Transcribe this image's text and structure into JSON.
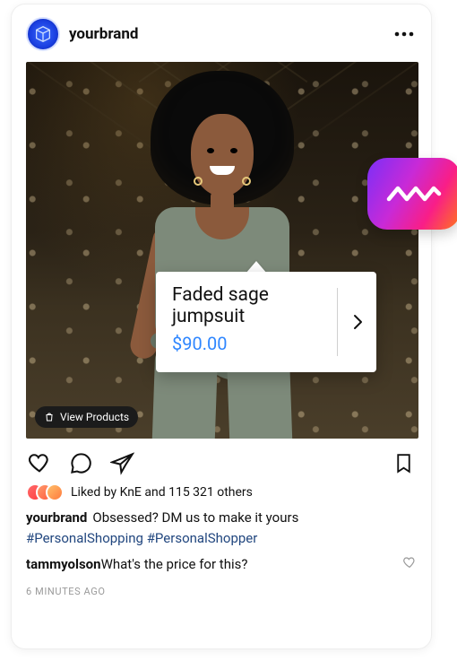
{
  "header": {
    "username": "yourbrand"
  },
  "product": {
    "name": "Faded sage jumpsuit",
    "price": "$90.00"
  },
  "view_products_label": "View Products",
  "likes": {
    "text": "Liked by KnE and 115 321 others"
  },
  "caption": {
    "user": "yourbrand",
    "text": "Obsessed? DM us to make it yours"
  },
  "hashtags": [
    "#PersonalShopping",
    "#PersonalShopper"
  ],
  "comment": {
    "user": "tammyolson",
    "text": "What's the price for this?"
  },
  "timestamp": "6 MINUTES AGO"
}
